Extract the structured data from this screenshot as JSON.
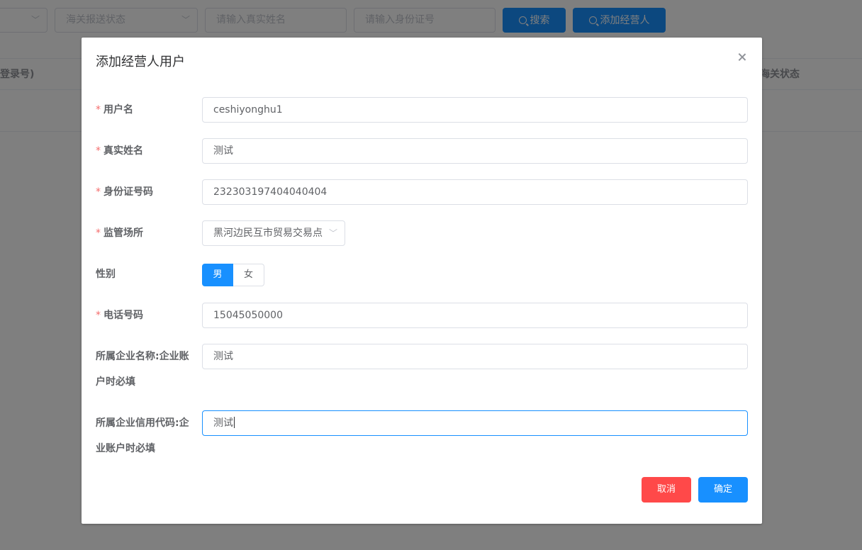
{
  "background": {
    "filters": {
      "select1_placeholder": "",
      "customs_status_placeholder": "海关报送状态",
      "real_name_placeholder": "请输入真实姓名",
      "id_number_placeholder": "请输入身份证号"
    },
    "buttons": {
      "search_label": "搜索",
      "add_operator_label": "添加经营人"
    },
    "table_headers": {
      "left": "登录号)",
      "right": "海关状态"
    }
  },
  "dialog": {
    "title": "添加经营人用户",
    "fields": {
      "username": {
        "label": "用户名",
        "value": "ceshiyonghu1"
      },
      "real_name": {
        "label": "真实姓名",
        "value": "测试"
      },
      "id_number": {
        "label": "身份证号码",
        "value": "232303197404040404"
      },
      "site": {
        "label": "监管场所",
        "value": "黑河边民互市贸易交易点"
      },
      "gender": {
        "label": "性别",
        "options": [
          "男",
          "女"
        ],
        "selected": "男"
      },
      "phone": {
        "label": "电话号码",
        "value": "15045050000"
      },
      "company_name": {
        "label": "所属企业名称:企业账户时必填",
        "value": "测试"
      },
      "credit_code": {
        "label": "所属企业信用代码:企业账户时必填",
        "value": "测试"
      }
    },
    "buttons": {
      "cancel": "取消",
      "confirm": "确定"
    },
    "required_mark": "*"
  },
  "colors": {
    "primary": "#1890ff",
    "danger": "#ff4949",
    "required": "#f56c6c"
  }
}
